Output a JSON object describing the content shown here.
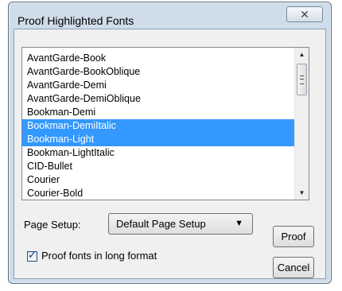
{
  "window": {
    "title": "Proof Highlighted Fonts",
    "close_glyph": "✕"
  },
  "fonts": [
    {
      "label": "AvantGarde-Book",
      "selected": false
    },
    {
      "label": "AvantGarde-BookOblique",
      "selected": false
    },
    {
      "label": "AvantGarde-Demi",
      "selected": false
    },
    {
      "label": "AvantGarde-DemiOblique",
      "selected": false
    },
    {
      "label": "Bookman-Demi",
      "selected": false
    },
    {
      "label": "Bookman-DemiItalic",
      "selected": true
    },
    {
      "label": "Bookman-Light",
      "selected": true
    },
    {
      "label": "Bookman-LightItalic",
      "selected": false
    },
    {
      "label": "CID-Bullet",
      "selected": false
    },
    {
      "label": "Courier",
      "selected": false
    },
    {
      "label": "Courier-Bold",
      "selected": false
    }
  ],
  "page_setup": {
    "label": "Page Setup:",
    "value": "Default Page Setup"
  },
  "long_format": {
    "label": "Proof fonts in long format",
    "checked": true
  },
  "buttons": {
    "proof": "Proof",
    "cancel": "Cancel"
  },
  "colors": {
    "selection": "#3399ff",
    "selection_text": "#ffffff"
  },
  "icons": {
    "scroll_up": "▲",
    "scroll_down": "▼",
    "dropdown": "▼",
    "check": "✓"
  }
}
